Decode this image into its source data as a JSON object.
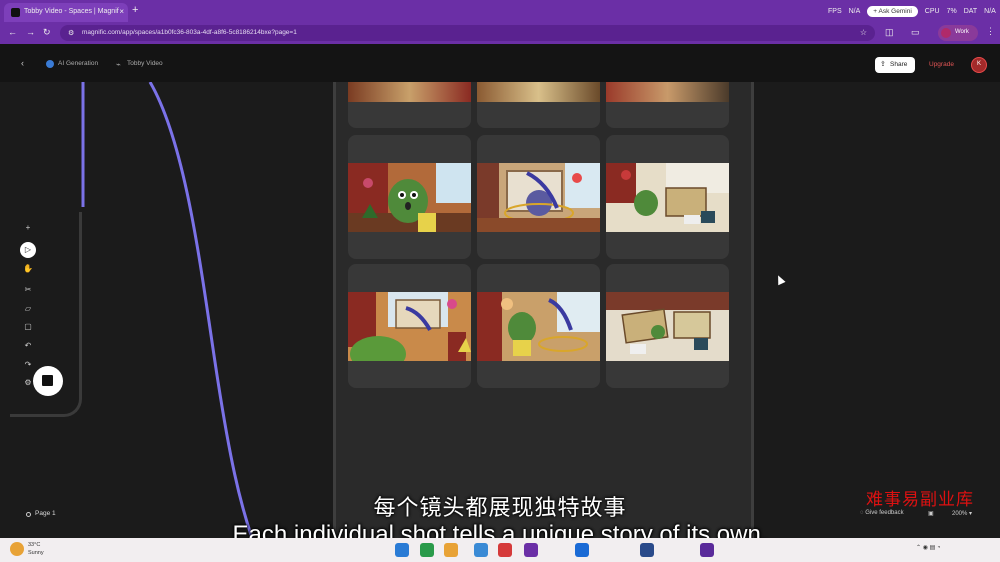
{
  "browser": {
    "tab_title": "Tobby Video - Spaces | Magnif",
    "tab_close": "×",
    "new_tab": "+",
    "url": "magnific.com/app/spaces/a1b0fc36-803a-4df-a8f6-5c8186214bxe?page=1",
    "overlay": {
      "fps_label": "FPS",
      "fps_value": "N/A",
      "ask_label": "+ Ask Gemini",
      "cpu_label": "CPU",
      "cpu_value": "7%",
      "dat_label": "DAT",
      "dat_value": "N/A"
    },
    "profile_label": "Work"
  },
  "app": {
    "breadcrumb": [
      "AI Generation",
      "Tobby Video"
    ],
    "share_label": "Share",
    "upgrade_label": "Upgrade",
    "avatar_initials": "K",
    "page_label": "Page 1",
    "feedback_label": "Give feedback",
    "zoom_label": "200%"
  },
  "toolbar_icons": [
    "plus-icon",
    "play-icon",
    "hand-icon",
    "scissors-icon",
    "shape-icon",
    "comment-icon",
    "undo-icon",
    "redo-icon",
    "settings-icon"
  ],
  "subtitles": {
    "chinese": "每个镜头都展现独特故事",
    "english": "Each individual shot tells a unique story of its own."
  },
  "watermark": "难事易副业库",
  "taskbar": {
    "temp": "33°C",
    "condition": "Sunny"
  },
  "colors": {
    "browser": "#6b2fa6",
    "accent_curve": "#7b72e8",
    "upgrade": "#e25555"
  }
}
